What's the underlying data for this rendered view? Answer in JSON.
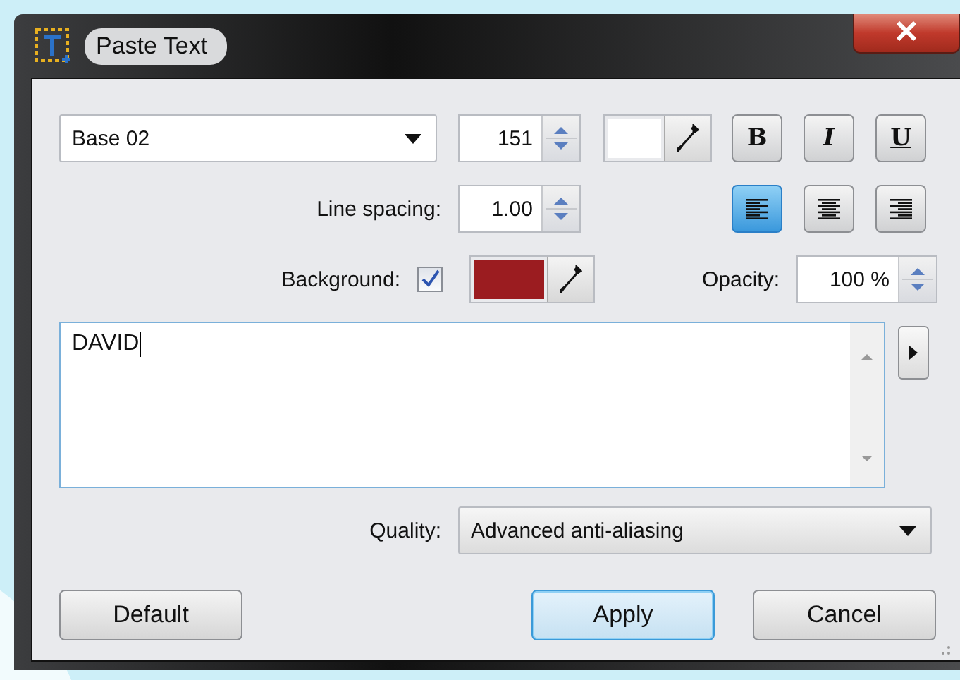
{
  "window": {
    "title": "Paste Text"
  },
  "font": {
    "value": "Base 02"
  },
  "size": {
    "value": "151"
  },
  "text_color": {
    "color": "#ffffff"
  },
  "styles": [
    {
      "kind": "bold",
      "label": "B",
      "selected": false
    },
    {
      "kind": "italic",
      "label": "I",
      "selected": false
    },
    {
      "kind": "underline",
      "label": "U",
      "selected": false
    }
  ],
  "line_spacing": {
    "label": "Line spacing:",
    "value": "1.00"
  },
  "alignment": [
    {
      "kind": "left",
      "selected": true
    },
    {
      "kind": "center",
      "selected": false
    },
    {
      "kind": "right",
      "selected": false
    }
  ],
  "background": {
    "label": "Background:",
    "checked": true,
    "color": "#9b1c20"
  },
  "opacity": {
    "label": "Opacity:",
    "value": "100 %"
  },
  "text": {
    "value": "DAVID"
  },
  "quality": {
    "label": "Quality:",
    "value": "Advanced anti-aliasing"
  },
  "buttons": [
    {
      "label": "Default",
      "selected": false
    },
    {
      "label": "Apply",
      "selected": true
    },
    {
      "label": "Cancel",
      "selected": false
    }
  ]
}
